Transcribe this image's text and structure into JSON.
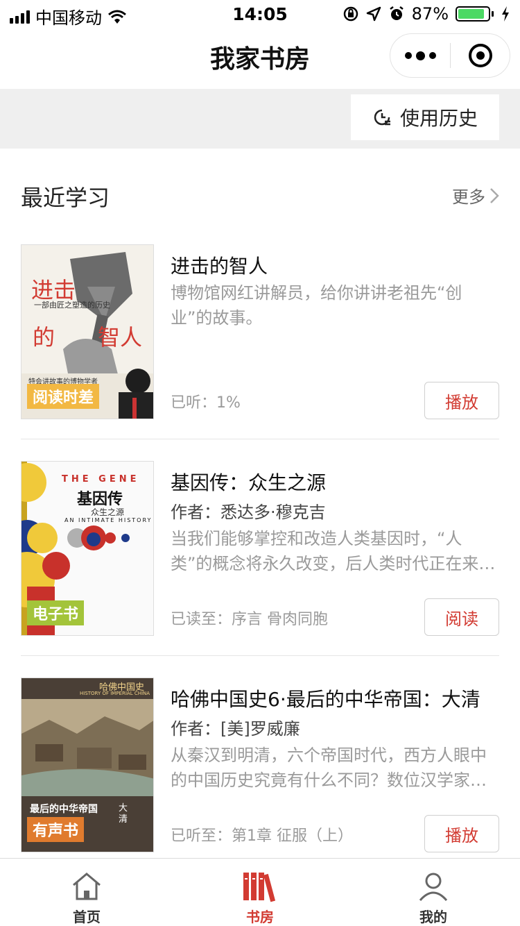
{
  "status_bar": {
    "carrier": "中国移动",
    "time": "14:05",
    "battery_percent": "87%",
    "battery_level": 0.87,
    "icons": [
      "signal-icon",
      "wifi-icon",
      "rotation-lock-icon",
      "location-icon",
      "alarm-icon",
      "charging-icon"
    ]
  },
  "nav": {
    "title": "我家书房"
  },
  "history": {
    "label": "使用历史"
  },
  "section": {
    "title": "最近学习",
    "more_label": "更多"
  },
  "books": [
    {
      "title": "进击的智人",
      "author": "",
      "description": "博物馆网红讲解员，给你讲讲老祖先“创业”的故事。",
      "progress": "已听：1%",
      "action": "播放",
      "cover_tag": "阅读时差",
      "cover_texts": {
        "big1": "进击",
        "big2": "的",
        "big3": "智人",
        "sub": "一部由匠之塑造的历史",
        "bottom": "特会讲故事的博物学者"
      }
    },
    {
      "title": "基因传：众生之源",
      "author": "作者：悉达多·穆克吉",
      "description": "当我们能够掌控和改造人类基因时，“人类”的概念将永久改变，后人类时代正在来…",
      "progress": "已读至：序言 骨肉同胞",
      "action": "阅读",
      "cover_tag": "电子书",
      "cover_texts": {
        "en_title": "THE GENE",
        "cn_title": "基因传",
        "cn_sub": "众生之源",
        "en_sub": "AN INTIMATE HISTORY"
      }
    },
    {
      "title": "哈佛中国史6·最后的中华帝国：大清",
      "author": "作者：[美]罗威廉",
      "description": "从秦汉到明清，六个帝国时代，西方人眼中的中国历史究竟有什么不同？数位汉学家…",
      "progress": "已听至：第1章 征服（上）",
      "action": "播放",
      "cover_tag": "有声书",
      "cover_texts": {
        "series": "哈佛中国史",
        "series_en": "HISTORY OF IMPERIAL CHINA",
        "main": "最后的中华帝国",
        "side": "大清"
      }
    }
  ],
  "tabs": [
    {
      "label": "首页",
      "icon": "home-icon",
      "active": false
    },
    {
      "label": "书房",
      "icon": "bookshelf-icon",
      "active": true
    },
    {
      "label": "我的",
      "icon": "user-icon",
      "active": false
    }
  ],
  "colors": {
    "accent": "#d23b32",
    "battery": "#4cd964",
    "strip_bg": "#efefef"
  }
}
